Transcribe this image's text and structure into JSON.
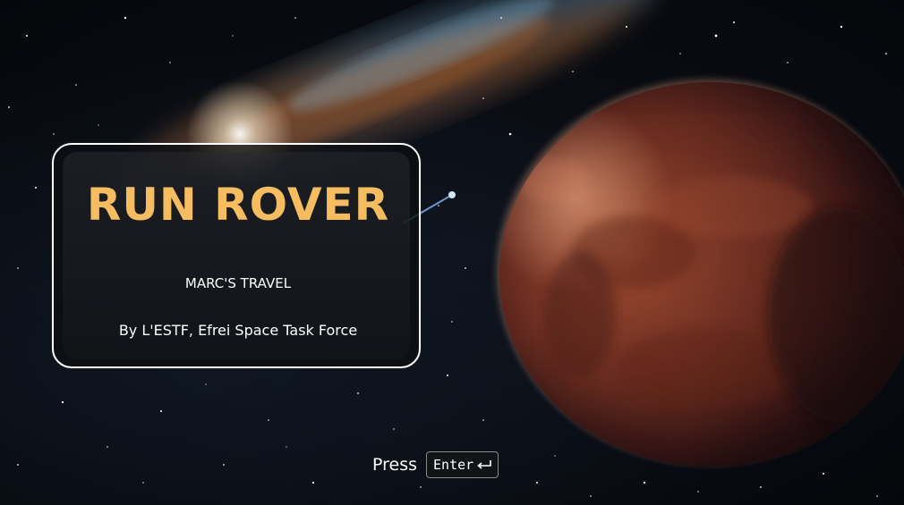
{
  "title_card": {
    "title": "RUN ROVER",
    "subtitle": "MARC'S TRAVEL",
    "credits": "By L'ESTF, Efrei Space Task Force"
  },
  "prompt": {
    "press_label": "Press",
    "key_label": "Enter"
  },
  "colors": {
    "title": "#f6bd60",
    "text": "#ffffff",
    "planet": "#8a3b28",
    "background": "#0a0d14"
  },
  "icons": {
    "enter_key_icon": "return-arrow-icon"
  }
}
